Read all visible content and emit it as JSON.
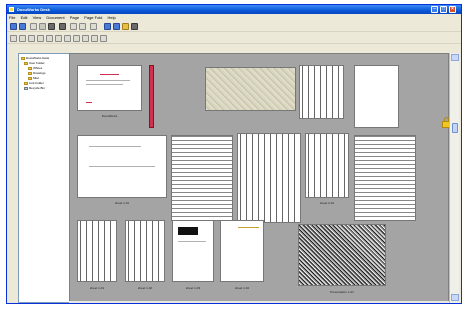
{
  "window": {
    "title": "DocuWorks Desk"
  },
  "menu": [
    "File",
    "Edit",
    "View",
    "Document",
    "Page",
    "Page Fold",
    "Help"
  ],
  "tree": {
    "items": [
      {
        "label": "DocuWorks Desk"
      },
      {
        "label": "User Folder"
      },
      {
        "label": "Offices"
      },
      {
        "label": "Drawings"
      },
      {
        "label": "Misc"
      },
      {
        "label": "Link Folder"
      },
      {
        "label": "Recycle Bin"
      }
    ]
  },
  "thumbnails": {
    "captions": [
      "DocuWorks",
      "sheet 1-01",
      "sheet 2-01",
      "sheet 1-01",
      "sheet 1-02",
      "sheet 1-03",
      "sheet 1-04",
      "sheet 1-05",
      "Presentation 1-01"
    ]
  },
  "icons": {
    "title": "app-icon",
    "lock": "lock-icon"
  }
}
